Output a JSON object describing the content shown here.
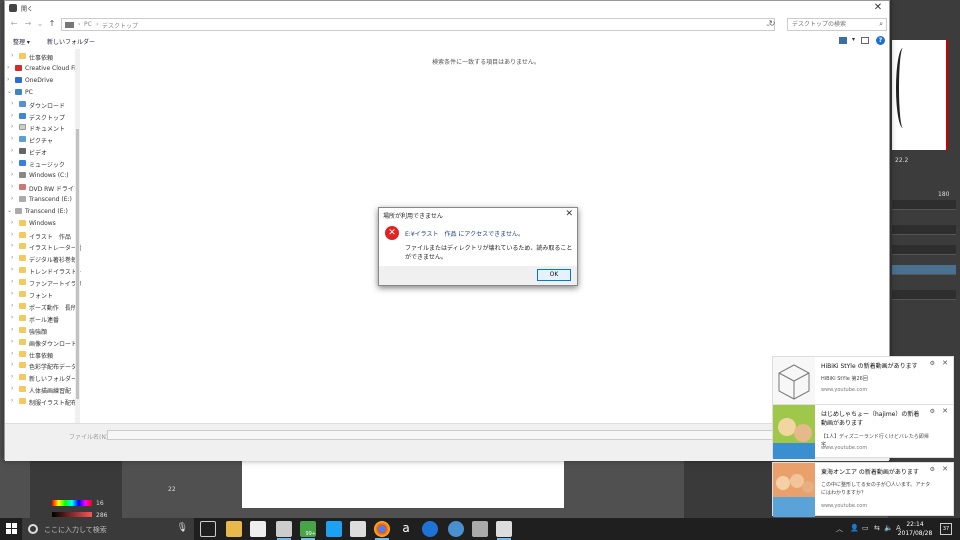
{
  "window": {
    "title": "開く",
    "address": {
      "crumbs": [
        "PC",
        "デスクトップ"
      ]
    },
    "search_placeholder": "デスクトップの検索",
    "toolbar": {
      "organize": "整理 ▾",
      "new_folder": "新しいフォルダー"
    },
    "empty_message": "検索条件に一致する項目はありません。",
    "filename_label": "ファイル名(N):"
  },
  "nav": {
    "items": [
      {
        "label": "仕事依頼",
        "icon": "folder-icon",
        "cls": "folder",
        "indent": 1
      },
      {
        "label": "Creative Cloud Fil",
        "icon": "creative-cloud-icon",
        "cls": "cloud",
        "indent": 0
      },
      {
        "label": "OneDrive",
        "icon": "onedrive-icon",
        "cls": "onedrive",
        "indent": 0
      },
      {
        "label": "PC",
        "icon": "pc-icon",
        "cls": "pcico",
        "indent": 0,
        "open": true
      },
      {
        "label": "ダウンロード",
        "icon": "download-icon",
        "cls": "dl",
        "indent": 1
      },
      {
        "label": "デスクトップ",
        "icon": "desktop-icon",
        "cls": "desk",
        "indent": 1
      },
      {
        "label": "ドキュメント",
        "icon": "document-icon",
        "cls": "doc",
        "indent": 1
      },
      {
        "label": "ピクチャ",
        "icon": "picture-icon",
        "cls": "pic",
        "indent": 1
      },
      {
        "label": "ビデオ",
        "icon": "video-icon",
        "cls": "vid",
        "indent": 1
      },
      {
        "label": "ミュージック",
        "icon": "music-icon",
        "cls": "mus",
        "indent": 1
      },
      {
        "label": "Windows (C:)",
        "icon": "drive-icon",
        "cls": "disk",
        "indent": 1
      },
      {
        "label": "DVD RW ドライブ",
        "icon": "dvd-icon",
        "cls": "dvd",
        "indent": 1
      },
      {
        "label": "Transcend (E:)",
        "icon": "usb-drive-icon",
        "cls": "usb",
        "indent": 1
      },
      {
        "label": "Transcend (E:)",
        "icon": "usb-drive-icon",
        "cls": "usb",
        "indent": 0,
        "open": true
      },
      {
        "label": "Windows",
        "icon": "folder-icon",
        "cls": "folder",
        "indent": 1
      },
      {
        "label": "イラスト　作品",
        "icon": "folder-icon",
        "cls": "folder",
        "indent": 1
      },
      {
        "label": "イラストレーター番号",
        "icon": "folder-icon",
        "cls": "folder",
        "indent": 1
      },
      {
        "label": "デジタル著衫巻毎",
        "icon": "folder-icon",
        "cls": "folder",
        "indent": 1
      },
      {
        "label": "トレンドイラスト_長",
        "icon": "folder-icon",
        "cls": "folder",
        "indent": 1
      },
      {
        "label": "ファンアートイラスト",
        "icon": "folder-icon",
        "cls": "folder",
        "indent": 1
      },
      {
        "label": "フォント",
        "icon": "folder-icon",
        "cls": "folder",
        "indent": 1
      },
      {
        "label": "ポーズ動作　長所",
        "icon": "folder-icon",
        "cls": "folder",
        "indent": 1
      },
      {
        "label": "ボール連番",
        "icon": "folder-icon",
        "cls": "folder",
        "indent": 1
      },
      {
        "label": "強強顔",
        "icon": "folder-icon",
        "cls": "folder",
        "indent": 1
      },
      {
        "label": "画像ダウンロード",
        "icon": "folder-icon",
        "cls": "folder",
        "indent": 1
      },
      {
        "label": "仕事依頼",
        "icon": "folder-icon",
        "cls": "folder",
        "indent": 1
      },
      {
        "label": "色彩学配布データ",
        "icon": "folder-icon",
        "cls": "folder",
        "indent": 1
      },
      {
        "label": "新しいフォルダー",
        "icon": "folder-icon",
        "cls": "folder",
        "indent": 1
      },
      {
        "label": "人体描画練習配",
        "icon": "folder-icon",
        "cls": "folder",
        "indent": 1
      },
      {
        "label": "制服イラスト配布",
        "icon": "folder-icon",
        "cls": "folder",
        "indent": 1
      }
    ]
  },
  "dialog": {
    "title": "場所が利用できません",
    "line1": "E:¥イラスト　作品 にアクセスできません。",
    "line2": "ファイルまたはディレクトリが壊れているため、読み取ることができません。",
    "ok": "OK"
  },
  "toasts": [
    {
      "title": "HiBiKi StYle の新着動画があります",
      "body": "HiBiKi StYle 第26回",
      "src": "www.youtube.com",
      "thumb": "#f7f7f7"
    },
    {
      "title": "はじめしゃちょー（hajime）の新着動画があります",
      "body": "【1人】ディズニーランド行くけどバレたら即帰宅",
      "src": "www.youtube.com",
      "thumb": "#9fc84a"
    },
    {
      "title": "東海オンエア の新着動画があります",
      "body": "この中に整形してる女の子が〇人います。アナタにはわかりますか？",
      "src": "www.youtube.com",
      "thumb": "#e9a06a"
    }
  ],
  "bg_app": {
    "zoom": "22.2",
    "value_180": "180",
    "value_16": "16",
    "value_286": "286",
    "value_22": "22"
  },
  "taskbar": {
    "search_placeholder": "ここに入力して検索",
    "badge": "99+",
    "time": "22:14",
    "date": "2017/08/28",
    "notif_count": "37",
    "ime": "A"
  }
}
